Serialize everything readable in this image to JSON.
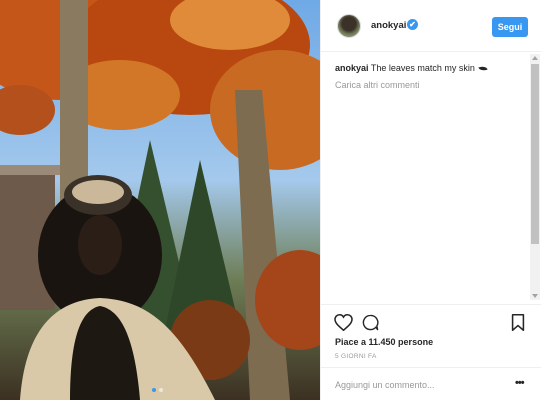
{
  "post": {
    "photo_alt": "photo",
    "carousel": {
      "total": 2,
      "active": 0
    }
  },
  "header": {
    "username": "anokyai",
    "verified_mark": "✔",
    "follow_label": "Segui"
  },
  "caption": {
    "username": "anokyai",
    "text": "The leaves match my skin"
  },
  "comments": {
    "load_more": "Carica altri commenti"
  },
  "actions": {
    "icons": [
      "heart-icon",
      "comment-icon",
      "bookmark-icon"
    ]
  },
  "likes": {
    "text": "Piace a 11.450 persone"
  },
  "timestamp": {
    "text": "5 GIORNI FA"
  },
  "add_comment": {
    "placeholder": "Aggiungi un commento...",
    "more_label": "•••"
  },
  "colors": {
    "accent": "#3897f0",
    "border": "#efefef",
    "muted": "#999999",
    "text": "#262626"
  }
}
